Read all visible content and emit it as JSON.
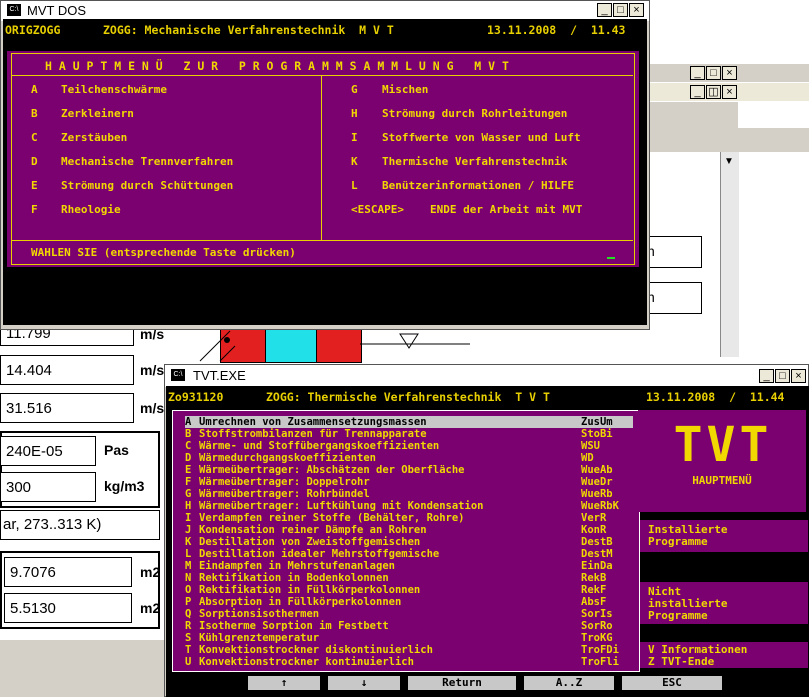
{
  "background_app": {
    "fields": [
      {
        "value": "11.799",
        "unit": "m/s"
      },
      {
        "value": "14.404",
        "unit": "m/s"
      },
      {
        "value": "31.516",
        "unit": "m/s"
      },
      {
        "value": "240E-05",
        "unit": "Pas"
      },
      {
        "value": "300",
        "unit": "kg/m3"
      },
      {
        "value": "ar, 273..313 K)",
        "unit": ""
      },
      {
        "value": "9.7076",
        "unit": "m2"
      },
      {
        "value": "5.5130",
        "unit": "m2"
      }
    ],
    "right_panel_labels": [
      "n",
      "n"
    ]
  },
  "mvt_window": {
    "title": "MVT DOS",
    "header_left": "ORIGZOGG",
    "header_mid": "ZOGG: Mechanische Verfahrenstechnik  M V T",
    "header_right": "13.11.2008  /  11.43",
    "menu_title": "H A U P T M E N Ü   Z U R   P R O G R A M M S A M M L U N G   M V T",
    "left_items": [
      {
        "key": "A",
        "label": "Teilchenschwärme"
      },
      {
        "key": "B",
        "label": "Zerkleinern"
      },
      {
        "key": "C",
        "label": "Zerstäuben"
      },
      {
        "key": "D",
        "label": "Mechanische Trennverfahren"
      },
      {
        "key": "E",
        "label": "Strömung durch Schüttungen"
      },
      {
        "key": "F",
        "label": "Rheologie"
      }
    ],
    "right_items": [
      {
        "key": "G",
        "label": "Mischen"
      },
      {
        "key": "H",
        "label": "Strömung durch Rohrleitungen"
      },
      {
        "key": "I",
        "label": "Stoffwerte von Wasser und Luft"
      },
      {
        "key": "K",
        "label": "Thermische Verfahrenstechnik"
      },
      {
        "key": "L",
        "label": "Benützerinformationen / HILFE"
      },
      {
        "key": "<ESCAPE>",
        "label": "ENDE der Arbeit mit MVT"
      }
    ],
    "prompt": "WAHLEN SIE (entsprechende Taste drücken)"
  },
  "tvt_window": {
    "title": "TVT.EXE",
    "header_left": "Zo931120",
    "header_mid": "ZOGG: Thermische Verfahrenstechnik  T V T",
    "header_right": "13.11.2008  /  11.44",
    "items": [
      {
        "key": "A",
        "label": "Umrechnen von Zusammensetzungsmassen",
        "code": "ZusUm"
      },
      {
        "key": "B",
        "label": "Stoffstrombilanzen für Trennapparate",
        "code": "StoBi"
      },
      {
        "key": "C",
        "label": "Wärme- und Stoffübergangskoeffizienten",
        "code": "WSU"
      },
      {
        "key": "D",
        "label": "Wärmedurchgangskoeffizienten",
        "code": "WD"
      },
      {
        "key": "E",
        "label": "Wärmeübertrager: Abschätzen der Oberfläche",
        "code": "WueAb"
      },
      {
        "key": "F",
        "label": "Wärmeübertrager: Doppelrohr",
        "code": "WueDr"
      },
      {
        "key": "G",
        "label": "Wärmeübertrager: Rohrbündel",
        "code": "WueRb"
      },
      {
        "key": "H",
        "label": "Wärmeübertrager: Luftkühlung mit Kondensation",
        "code": "WueRbK"
      },
      {
        "key": "I",
        "label": "Verdampfen reiner Stoffe (Behälter, Rohre)",
        "code": "VerR"
      },
      {
        "key": "J",
        "label": "Kondensation reiner Dämpfe an Rohren",
        "code": "KonR"
      },
      {
        "key": "K",
        "label": "Destillation von Zweistoffgemischen",
        "code": "DestB"
      },
      {
        "key": "L",
        "label": "Destillation idealer Mehrstoffgemische",
        "code": "DestM"
      },
      {
        "key": "M",
        "label": "Eindampfen in Mehrstufenanlagen",
        "code": "EinDa"
      },
      {
        "key": "N",
        "label": "Rektifikation in Bodenkolonnen",
        "code": "RekB"
      },
      {
        "key": "O",
        "label": "Rektifikation in Füllkörperkolonnen",
        "code": "RekF"
      },
      {
        "key": "P",
        "label": "Absorption in Füllkörperkolonnen",
        "code": "AbsF"
      },
      {
        "key": "Q",
        "label": "Sorptionsisothermen",
        "code": "SorIs"
      },
      {
        "key": "R",
        "label": "Isotherme Sorption im Festbett",
        "code": "SorRo"
      },
      {
        "key": "S",
        "label": "Kühlgrenztemperatur",
        "code": "TroKG"
      },
      {
        "key": "T",
        "label": "Konvektionstrockner diskontinuierlich",
        "code": "TroFDi"
      },
      {
        "key": "U",
        "label": "Konvektionstrockner kontinuierlich",
        "code": "TroFli"
      }
    ],
    "logo_text": "TVT",
    "logo_caption": "HAUPTMENÜ",
    "installed_label": "Installierte\nProgramme",
    "not_installed_label": "Nicht\ninstallierte\nProgramme",
    "info_label": "V Informationen",
    "end_label": "Z TVT-Ende",
    "bottom_buttons": [
      "↑",
      "↓",
      "Return",
      "A..Z",
      "ESC"
    ]
  },
  "colors": {
    "console_purple": "#7b0070",
    "console_yellow": "#f0d800",
    "console_black": "#000000"
  }
}
